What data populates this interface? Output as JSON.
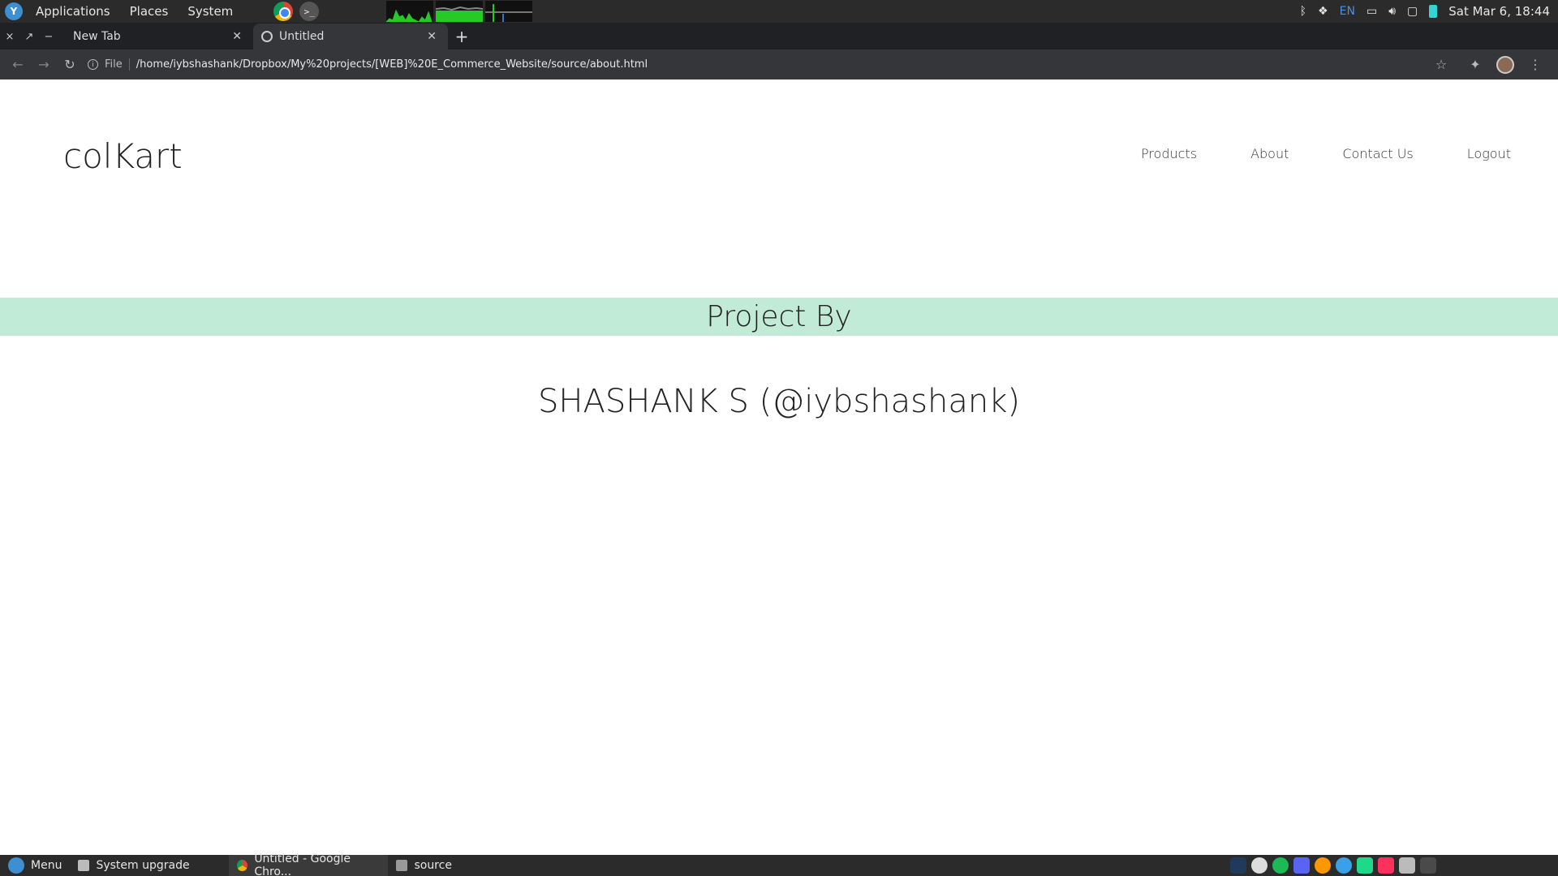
{
  "top_panel": {
    "menus": [
      "Applications",
      "Places",
      "System"
    ],
    "tray_lang": "EN",
    "clock": "Sat Mar  6, 18:44"
  },
  "browser": {
    "tabs": [
      {
        "title": "New Tab"
      },
      {
        "title": "Untitled"
      }
    ],
    "window_controls": [
      "×",
      "↗",
      "−"
    ],
    "scheme_label": "File",
    "url": "/home/iybshashank/Dropbox/My%20projects/[WEB]%20E_Commerce_Website/source/about.html"
  },
  "page": {
    "brand": "colKart",
    "nav": [
      "Products",
      "About",
      "Contact Us",
      "Logout"
    ],
    "banner_title": "Project By",
    "author": "SHASHANK S (@iybshashank)",
    "banner_color": "#c1ebd6"
  },
  "taskbar": {
    "menu_label": "Menu",
    "items": [
      "System upgrade",
      "Untitled - Google Chro...",
      "source"
    ]
  }
}
